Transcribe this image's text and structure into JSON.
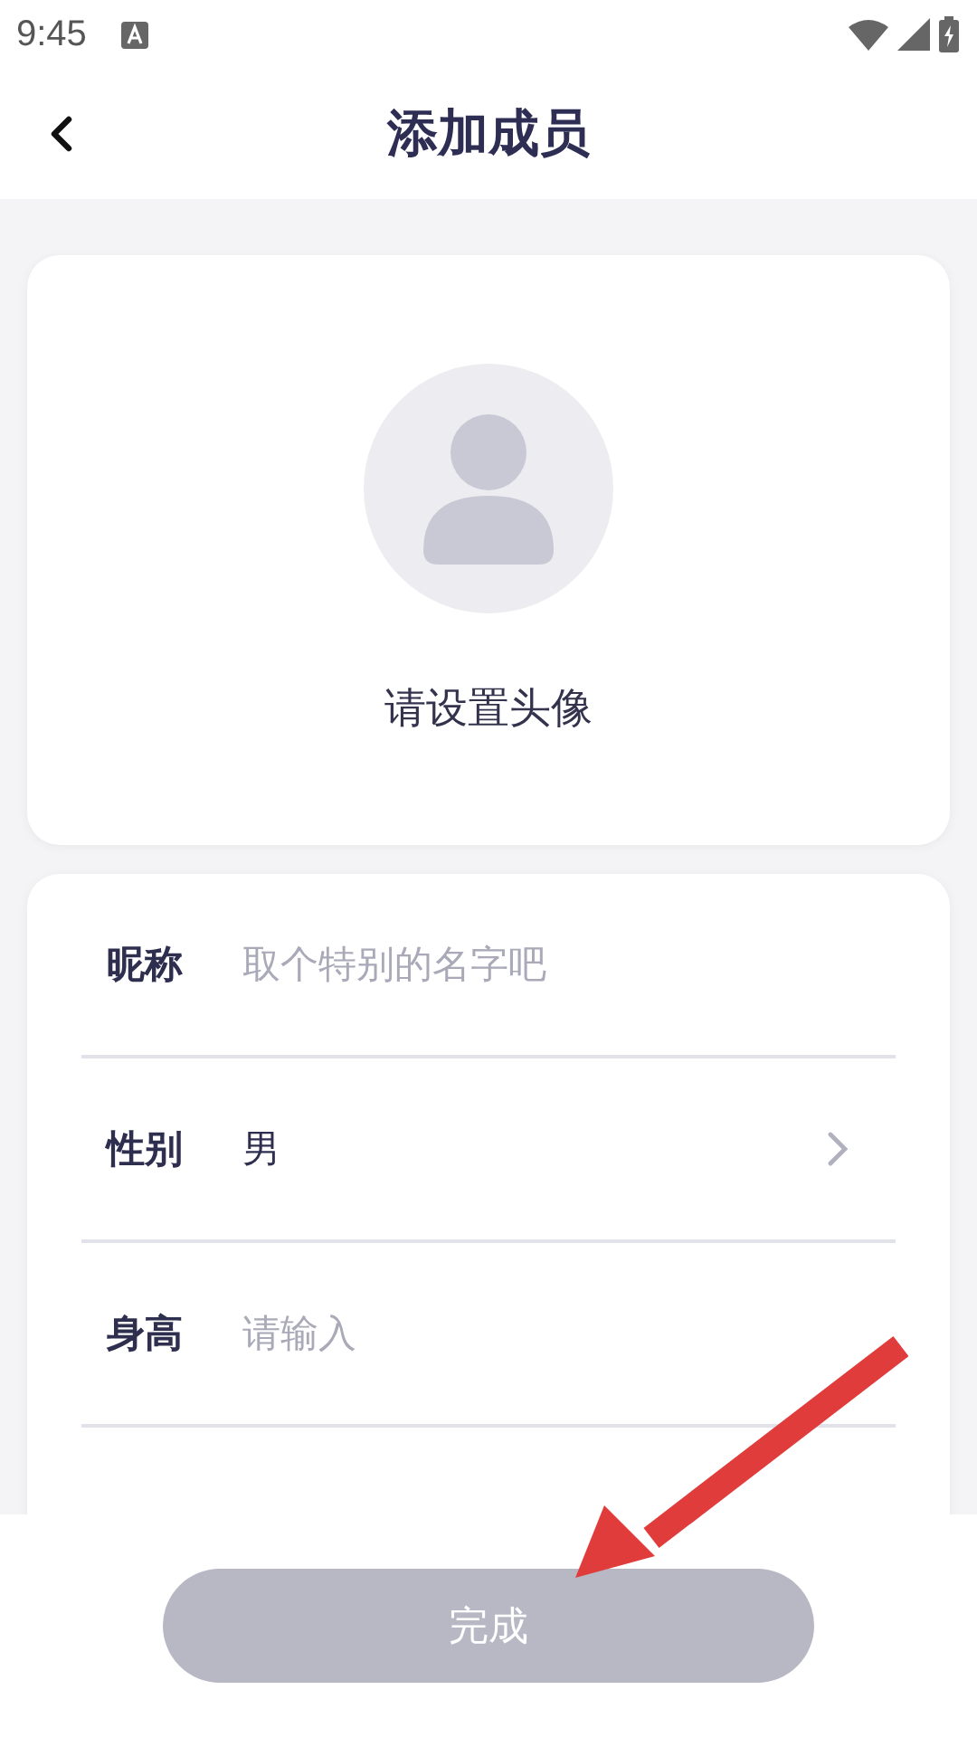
{
  "status_bar": {
    "time": "9:45"
  },
  "header": {
    "title": "添加成员"
  },
  "avatar": {
    "prompt": "请设置头像"
  },
  "form": {
    "rows": [
      {
        "kind": "input",
        "label": "昵称",
        "placeholder": "取个特别的名字吧"
      },
      {
        "kind": "select",
        "label": "性别",
        "value": "男"
      },
      {
        "kind": "input",
        "label": "身高",
        "placeholder": "请输入"
      }
    ]
  },
  "submit": {
    "label": "完成",
    "disabled": true
  }
}
